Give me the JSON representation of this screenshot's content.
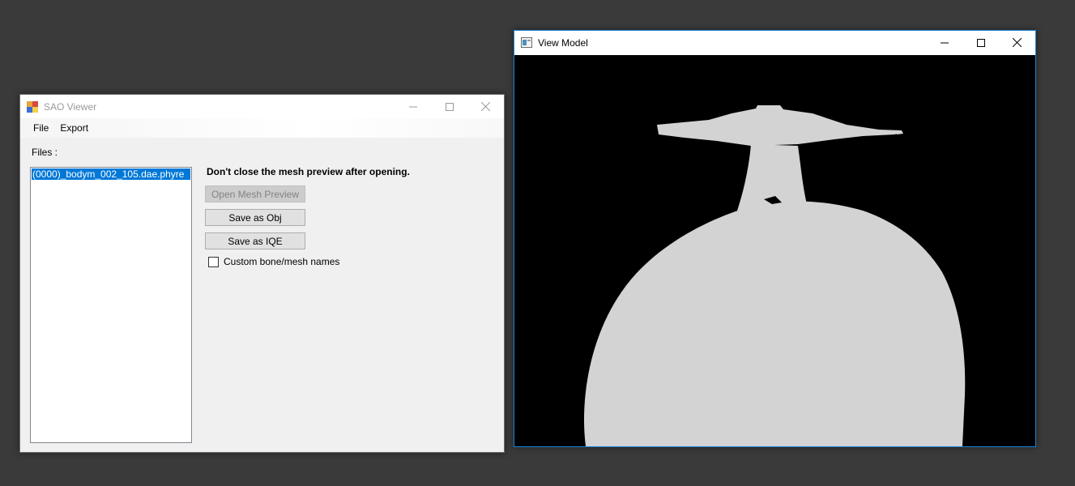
{
  "sao_window": {
    "title": "SAO Viewer",
    "menu": [
      "File",
      "Export"
    ],
    "files_label": "Files :",
    "files": [
      "(0000)_bodym_002_105.dae.phyre"
    ],
    "warning": "Don't close the mesh preview after opening.",
    "buttons": {
      "open_mesh_preview": "Open Mesh Preview",
      "save_as_obj": "Save as Obj",
      "save_as_iqe": "Save as IQE"
    },
    "checkbox": {
      "label": "Custom bone/mesh names",
      "checked": false
    }
  },
  "view_window": {
    "title": "View Model"
  },
  "icons": {
    "minimize": "minimize-icon",
    "maximize": "maximize-icon",
    "close": "close-icon"
  },
  "colors": {
    "selection": "#0078d7",
    "window_accent_border": "#1883d7",
    "model_fill": "#d3d3d3",
    "viewport_bg": "#000000"
  }
}
